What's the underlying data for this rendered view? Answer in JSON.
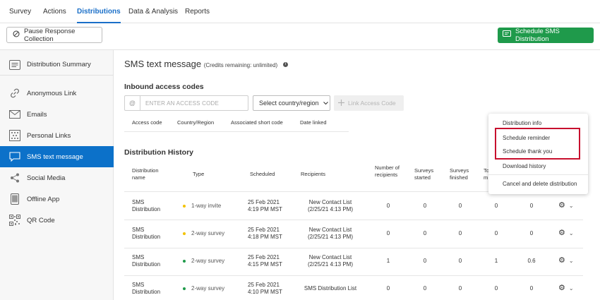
{
  "topnav": {
    "tabs": [
      "Survey",
      "Actions",
      "Distributions",
      "Data & Analysis",
      "Reports"
    ],
    "active": "Distributions"
  },
  "toolbar": {
    "pause_label": "Pause Response Collection",
    "schedule_label": "Schedule SMS Distribution"
  },
  "sidebar": {
    "items": [
      "Distribution Summary",
      "Anonymous Link",
      "Emails",
      "Personal Links",
      "SMS text message",
      "Social Media",
      "Offline App",
      "QR Code"
    ],
    "active": "SMS text message"
  },
  "main": {
    "title": "SMS text message",
    "credits": "(Credits remaining: unlimited)"
  },
  "inbound": {
    "heading": "Inbound access codes",
    "at_symbol": "@",
    "code_placeholder": "ENTER AN ACCESS CODE",
    "country_select": "Select country/region",
    "link_button": "Link Access Code",
    "columns": [
      "Access code",
      "Country/Region",
      "Associated short code",
      "Date linked"
    ]
  },
  "history": {
    "heading": "Distribution History",
    "columns": {
      "name": "Distribution name",
      "type": "Type",
      "scheduled": "Scheduled",
      "recipients": "Recipients",
      "num_recipients": "Number of recipients",
      "started": "Surveys started",
      "finished": "Surveys finished",
      "partial": "To m"
    },
    "rows": [
      {
        "name": "SMS Distribution",
        "type": "1-way invite",
        "type_color": "#f2c200",
        "date": "25 Feb 2021",
        "time": "4:19 PM MST",
        "recipients": "New Contact List",
        "recipients_sub": "(2/25/21 4:13 PM)",
        "num": "0",
        "started": "0",
        "finished": "0",
        "col8": "0",
        "col9": "0"
      },
      {
        "name": "SMS Distribution",
        "type": "2-way survey",
        "type_color": "#f2c200",
        "date": "25 Feb 2021",
        "time": "4:18 PM MST",
        "recipients": "New Contact List",
        "recipients_sub": "(2/25/21 4:13 PM)",
        "num": "0",
        "started": "0",
        "finished": "0",
        "col8": "0",
        "col9": "0"
      },
      {
        "name": "SMS Distribution",
        "type": "2-way survey",
        "type_color": "#1f9a4b",
        "date": "25 Feb 2021",
        "time": "4:15 PM MST",
        "recipients": "New Contact List",
        "recipients_sub": "(2/25/21 4:13 PM)",
        "num": "1",
        "started": "0",
        "finished": "0",
        "col8": "1",
        "col9": "0.6"
      },
      {
        "name": "SMS Distribution",
        "type": "2-way survey",
        "type_color": "#1f9a4b",
        "date": "25 Feb 2021",
        "time": "4:10 PM MST",
        "recipients": "SMS Distribution List",
        "recipients_sub": "",
        "num": "0",
        "started": "0",
        "finished": "0",
        "col8": "0",
        "col9": "0"
      }
    ]
  },
  "context_menu": {
    "items": [
      "Distribution info",
      "Schedule reminder",
      "Schedule thank you",
      "Download history",
      "Cancel and delete distribution"
    ],
    "highlight_color": "#c8102e"
  },
  "colors": {
    "accent": "#0c71c9",
    "schedule_button": "#1f9a4b"
  }
}
